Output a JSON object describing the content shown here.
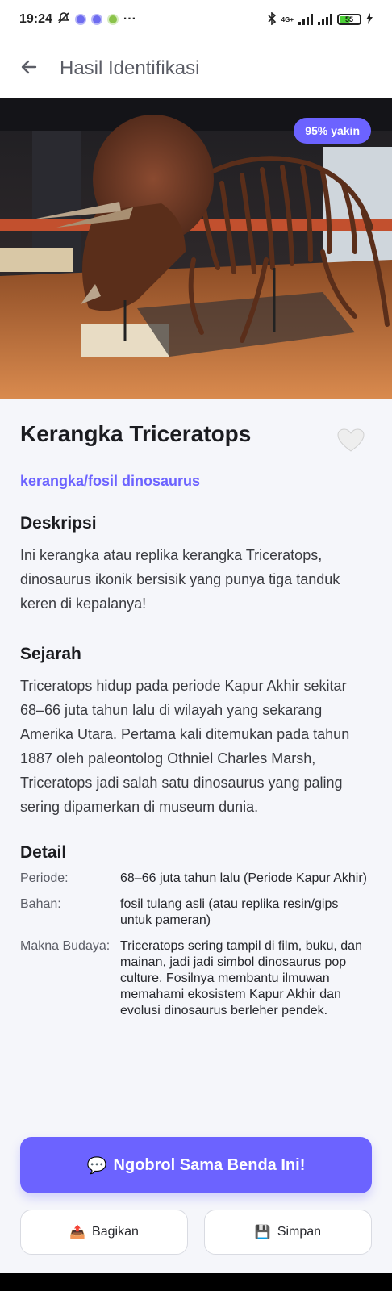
{
  "status_bar": {
    "time": "19:24",
    "dots": "···",
    "network": "4G+",
    "battery": "55",
    "battery_level": 0.55
  },
  "app_bar": {
    "title": "Hasil Identifikasi",
    "back_icon": "arrow-left-icon"
  },
  "hero": {
    "confidence_label": "95% yakin"
  },
  "object": {
    "title": "Kerangka Triceratops",
    "category": "kerangka/fosil dinosaurus",
    "favorite_icon": "heart-icon"
  },
  "description": {
    "heading": "Deskripsi",
    "text": "Ini kerangka atau replika kerangka Triceratops, dinosaurus ikonik bersisik yang punya tiga tanduk keren di kepalanya!"
  },
  "history": {
    "heading": "Sejarah",
    "text": "Triceratops hidup pada periode Kapur Akhir sekitar 68–66 juta tahun lalu di wilayah yang sekarang Amerika Utara. Pertama kali ditemukan pada tahun 1887 oleh paleontolog Othniel Charles Marsh, Triceratops jadi salah satu dinosaurus yang paling sering dipamerkan di museum dunia."
  },
  "detail": {
    "heading": "Detail",
    "rows": [
      {
        "key": "Periode:",
        "value": "68–66 juta tahun lalu (Periode Kapur Akhir)"
      },
      {
        "key": "Bahan:",
        "value": "fosil tulang asli (atau replika resin/gips untuk pameran)"
      },
      {
        "key": "Makna Budaya:",
        "value": "Triceratops sering tampil di film, buku, dan mainan, jadi jadi simbol dinosaurus pop culture. Fosilnya membantu ilmuwan memahami ekosistem Kapur Akhir dan evolusi dinosaurus berleher pendek."
      }
    ]
  },
  "actions": {
    "chat_icon": "💬",
    "chat_label": "Ngobrol Sama Benda Ini!",
    "share_icon": "📤",
    "share_label": "Bagikan",
    "save_icon": "💾",
    "save_label": "Simpan"
  },
  "colors": {
    "accent": "#6c63ff",
    "background": "#f5f6fa"
  }
}
